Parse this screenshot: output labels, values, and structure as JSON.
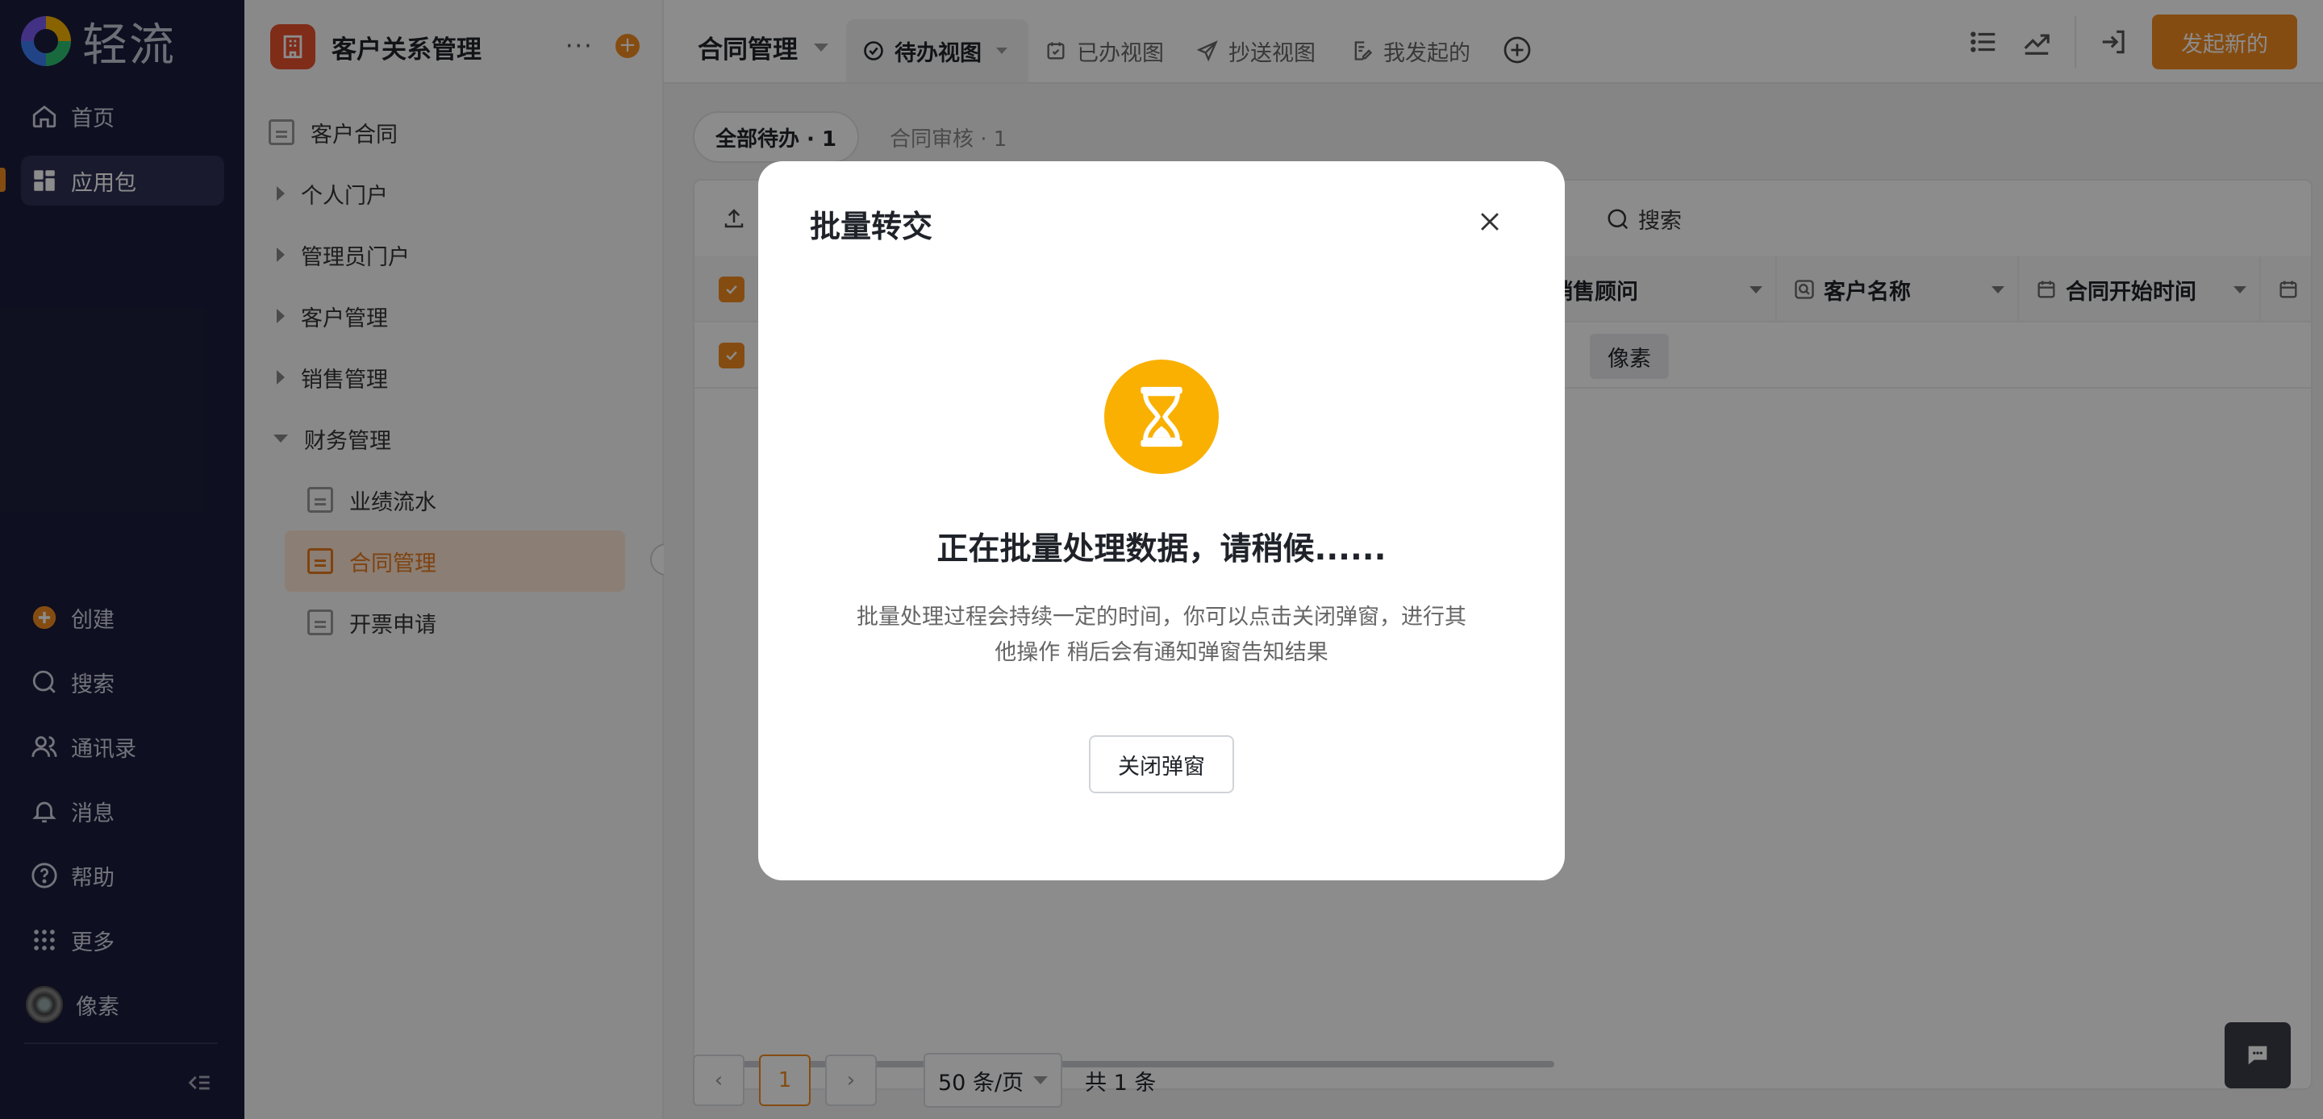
{
  "nav": {
    "logo_text": "轻流",
    "items": [
      {
        "label": "首页",
        "icon": "home-icon"
      },
      {
        "label": "应用包",
        "icon": "apps-icon"
      }
    ],
    "bottom_items": [
      {
        "label": "创建",
        "icon": "create-icon"
      },
      {
        "label": "搜索",
        "icon": "search-icon"
      },
      {
        "label": "通讯录",
        "icon": "contacts-icon"
      },
      {
        "label": "消息",
        "icon": "bell-icon"
      },
      {
        "label": "帮助",
        "icon": "help-icon"
      },
      {
        "label": "更多",
        "icon": "grid-icon"
      },
      {
        "label": "像素",
        "icon": "avatar"
      }
    ]
  },
  "sidebar": {
    "title": "客户关系管理",
    "more": "···",
    "items": [
      {
        "label": "客户合同"
      },
      {
        "label": "个人门户"
      },
      {
        "label": "管理员门户"
      },
      {
        "label": "客户管理"
      },
      {
        "label": "销售管理"
      },
      {
        "label": "财务管理"
      },
      {
        "label": "业绩流水"
      },
      {
        "label": "合同管理"
      },
      {
        "label": "开票申请"
      }
    ]
  },
  "topbar": {
    "title": "合同管理",
    "tabs": [
      {
        "label": "待办视图"
      },
      {
        "label": "已办视图"
      },
      {
        "label": "抄送视图"
      },
      {
        "label": "我发起的"
      }
    ],
    "start_button": "发起新的"
  },
  "content": {
    "filter_all": "全部待办 · 1",
    "filter_review": "合同审核 · 1",
    "search_label": "搜索",
    "columns": [
      {
        "label": "销售顾问"
      },
      {
        "label": "客户名称"
      },
      {
        "label": "合同开始时间"
      }
    ],
    "row_value": "像素",
    "pagination": {
      "current": "1",
      "page_size": "50 条/页",
      "total": "共 1 条"
    }
  },
  "modal": {
    "title": "批量转交",
    "heading": "正在批量处理数据，请稍候......",
    "description_line1": "批量处理过程会持续一定的时间，你可以点击关闭弹窗，进行其",
    "description_line2": "他操作 稍后会有通知弹窗告知结果",
    "close_button": "关闭弹窗"
  },
  "colors": {
    "accent": "#f28a1f",
    "nav_bg": "#1b1d3b",
    "hourglass": "#f9b000"
  }
}
